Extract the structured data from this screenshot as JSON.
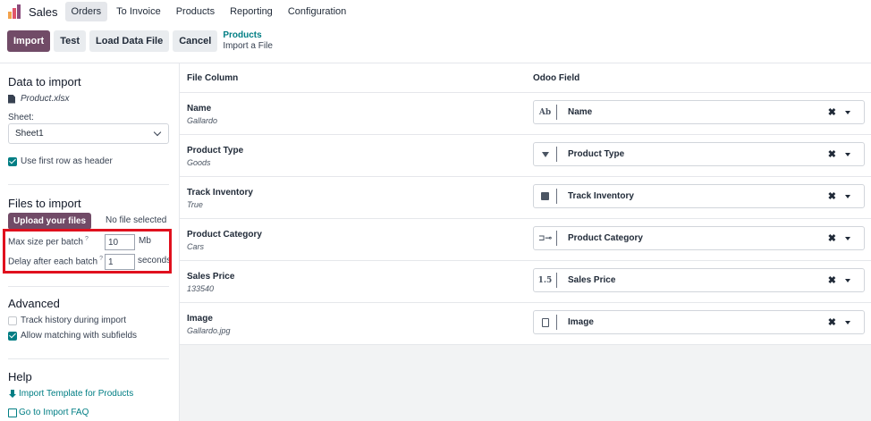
{
  "header": {
    "app_name": "Sales",
    "menu": [
      "Orders",
      "To Invoice",
      "Products",
      "Reporting",
      "Configuration"
    ],
    "active_menu": "Orders"
  },
  "toolbar": {
    "import_label": "Import",
    "test_label": "Test",
    "load_label": "Load Data File",
    "cancel_label": "Cancel",
    "breadcrumb_parent": "Products",
    "breadcrumb_current": "Import a File"
  },
  "sidebar": {
    "data_title": "Data to import",
    "file_name": "Product.xlsx",
    "sheet_label": "Sheet:",
    "sheet_value": "Sheet1",
    "header_checkbox": "Use first row as header",
    "files_title": "Files to import",
    "upload_label": "Upload your files",
    "no_file": "No file selected",
    "max_size_label": "Max size per batch",
    "max_size_value": "10",
    "max_size_unit": "Mb",
    "delay_label": "Delay after each batch",
    "delay_value": "1",
    "delay_unit": "seconds",
    "help_mark": "?",
    "advanced_title": "Advanced",
    "track_history": "Track history during import",
    "allow_matching": "Allow matching with subfields",
    "help_title": "Help",
    "template_link": "Import Template for Products",
    "faq_link": "Go to Import FAQ"
  },
  "table": {
    "col_file": "File Column",
    "col_field": "Odoo Field",
    "clear_glyph": "✖",
    "rows": [
      {
        "name": "Name",
        "sample": "Gallardo",
        "field": "Name",
        "icon": "text-icon",
        "icon_glyph": "Ab"
      },
      {
        "name": "Product Type",
        "sample": "Goods",
        "field": "Product Type",
        "icon": "selection-icon",
        "icon_glyph": ""
      },
      {
        "name": "Track Inventory",
        "sample": "True",
        "field": "Track Inventory",
        "icon": "checkbox-icon",
        "icon_glyph": ""
      },
      {
        "name": "Product Category",
        "sample": "Cars",
        "field": "Product Category",
        "icon": "relation-icon",
        "icon_glyph": "⊐⊸"
      },
      {
        "name": "Sales Price",
        "sample": "133540",
        "field": "Sales Price",
        "icon": "float-icon",
        "icon_glyph": "1.5"
      },
      {
        "name": "Image",
        "sample": "Gallardo.jpg",
        "field": "Image",
        "icon": "document-icon",
        "icon_glyph": ""
      }
    ]
  },
  "colors": {
    "brand": "#714b67",
    "accent": "#017e84",
    "highlight": "#e0101e"
  }
}
